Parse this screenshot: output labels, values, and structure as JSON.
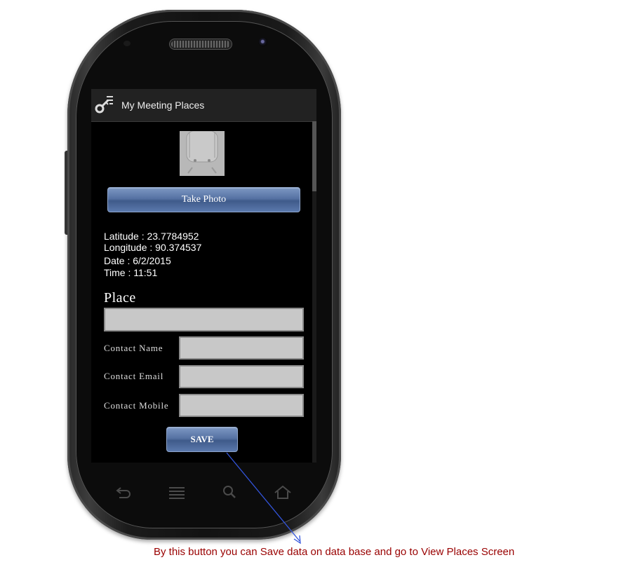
{
  "app": {
    "title": "My Meeting Places",
    "icon": "key-list-icon"
  },
  "photo": {
    "icon": "android-placeholder-icon"
  },
  "buttons": {
    "take_photo": "Take Photo",
    "save": "SAVE"
  },
  "info": {
    "latitude": "Latitude : 23.7784952",
    "longitude": "Longitude : 90.374537",
    "date": "Date : 6/2/2015",
    "time": "Time : 11:51"
  },
  "form": {
    "place_label": "Place",
    "place_value": "",
    "contact_name_label": "Contact Name",
    "contact_name_value": "",
    "contact_email_label": "Contact Email",
    "contact_email_value": "",
    "contact_mobile_label": "Contact Mobile",
    "contact_mobile_value": ""
  },
  "nav": {
    "back": "back-icon",
    "menu": "menu-icon",
    "search": "search-icon",
    "home": "home-icon"
  },
  "annotation": {
    "text": "By this button you can Save data on data base and go to View Places Screen",
    "color": "#990000"
  }
}
